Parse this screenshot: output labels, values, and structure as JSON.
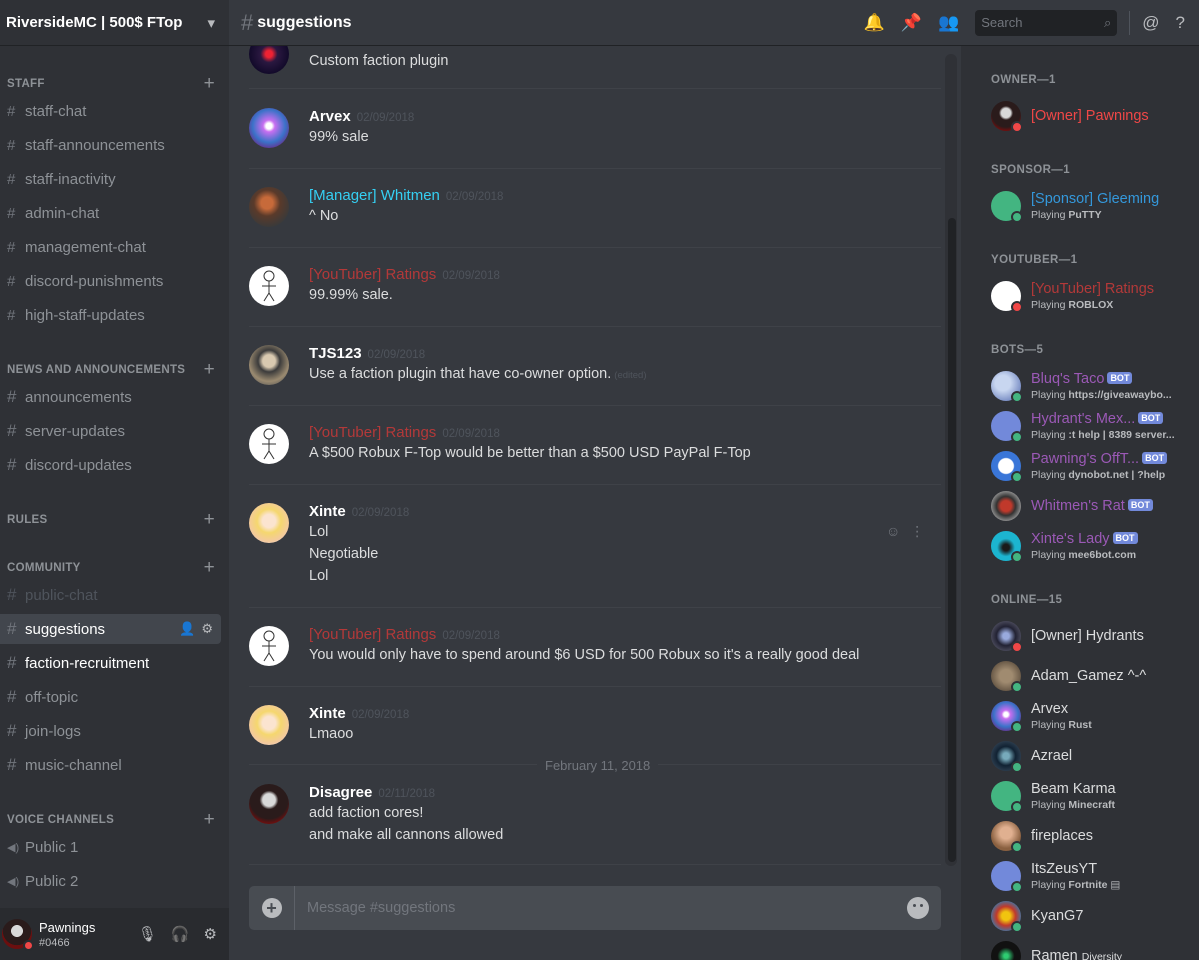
{
  "server": {
    "name": "RiversideMC | 500$ FTop"
  },
  "categories": {
    "staff": "STAFF",
    "news": "NEWS AND ANNOUNCEMENTS",
    "rules": "RULES",
    "community": "COMMUNITY",
    "voice": "VOICE CHANNELS"
  },
  "channels": {
    "staff": [
      "staff-chat",
      "staff-announcements",
      "staff-inactivity",
      "admin-chat",
      "management-chat",
      "discord-punishments",
      "high-staff-updates"
    ],
    "news": [
      "announcements",
      "server-updates",
      "discord-updates"
    ],
    "community": [
      "public-chat",
      "suggestions",
      "faction-recruitment",
      "off-topic",
      "join-logs",
      "music-channel"
    ],
    "voice": [
      "Public 1",
      "Public 2"
    ]
  },
  "user": {
    "name": "Pawnings",
    "tag": "#0466"
  },
  "topbar": {
    "channel": "suggestions",
    "search_placeholder": "Search"
  },
  "messages": [
    {
      "author": "",
      "time": "",
      "lines": [
        "Custom faction plugin"
      ]
    },
    {
      "author": "Arvex",
      "time": "02/09/2018",
      "lines": [
        "99% sale"
      ]
    },
    {
      "author": "[Manager] Whitmen",
      "time": "02/09/2018",
      "lines": [
        "^ No"
      ]
    },
    {
      "author": "[YouTuber] Ratings",
      "time": "02/09/2018",
      "lines": [
        "99.99% sale."
      ]
    },
    {
      "author": "TJS123",
      "time": "02/09/2018",
      "lines": [
        "Use a faction plugin that have co-owner option."
      ],
      "edited": "(edited)"
    },
    {
      "author": "[YouTuber] Ratings",
      "time": "02/09/2018",
      "lines": [
        "A $500 Robux F-Top would be better than a $500 USD PayPal F-Top"
      ]
    },
    {
      "author": "Xinte",
      "time": "02/09/2018",
      "lines": [
        "Lol",
        "Negotiable",
        "Lol"
      ]
    },
    {
      "author": "[YouTuber] Ratings",
      "time": "02/09/2018",
      "lines": [
        "You would only have to spend around $6 USD for 500 Robux so it's a really good deal"
      ]
    },
    {
      "author": "Xinte",
      "time": "02/09/2018",
      "lines": [
        "Lmaoo"
      ]
    },
    {
      "author": "Disagree",
      "time": "02/11/2018",
      "lines": [
        "add faction cores!",
        "and make all cannons allowed"
      ]
    }
  ],
  "date_divider": "February 11, 2018",
  "composer": {
    "placeholder": "Message #suggestions"
  },
  "members": {
    "roles": [
      "OWNER—1",
      "SPONSOR—1",
      "YOUTUBER—1",
      "BOTS—5",
      "ONLINE—15"
    ],
    "list": [
      {
        "name": "[Owner] Pawnings",
        "activity": ""
      },
      {
        "name": "[Sponsor] Gleeming",
        "activity_prefix": "Playing",
        "activity": "PuTTY"
      },
      {
        "name": "[YouTuber] Ratings",
        "activity_prefix": "Playing",
        "activity": "ROBLOX"
      },
      {
        "name": "Bluq's Taco",
        "activity_prefix": "Playing",
        "activity": "https://giveawaybo..."
      },
      {
        "name": "Hydrant's Mex...",
        "activity_prefix": "Playing",
        "activity": ":t help | 8389 server..."
      },
      {
        "name": "Pawning's OffT...",
        "activity_prefix": "Playing",
        "activity": "dynobot.net | ?help"
      },
      {
        "name": "Whitmen's Rat",
        "activity": ""
      },
      {
        "name": "Xinte's Lady",
        "activity_prefix": "Playing",
        "activity": "mee6bot.com"
      },
      {
        "name": "[Owner] Hydrants",
        "activity": ""
      },
      {
        "name": "Adam_Gamez ^-^",
        "activity": ""
      },
      {
        "name": "Arvex",
        "activity_prefix": "Playing",
        "activity": "Rust"
      },
      {
        "name": "Azrael",
        "activity": ""
      },
      {
        "name": "Beam Karma",
        "activity_prefix": "Playing",
        "activity": "Minecraft"
      },
      {
        "name": "fireplaces",
        "activity": ""
      },
      {
        "name": "ItsZeusYT",
        "activity_prefix": "Playing",
        "activity": "Fortnite"
      },
      {
        "name": "KyanG7",
        "activity": ""
      },
      {
        "name": "Ramen",
        "activity": "Diversity"
      }
    ],
    "bot_tag": "BOT"
  },
  "colors": {
    "owner": "#f04747",
    "sponsor": "#3498db",
    "youtuber": "#b33939",
    "bot": "#9b59b6",
    "manager": "#35d0f3",
    "online": "#43b581",
    "dnd": "#f04747"
  }
}
